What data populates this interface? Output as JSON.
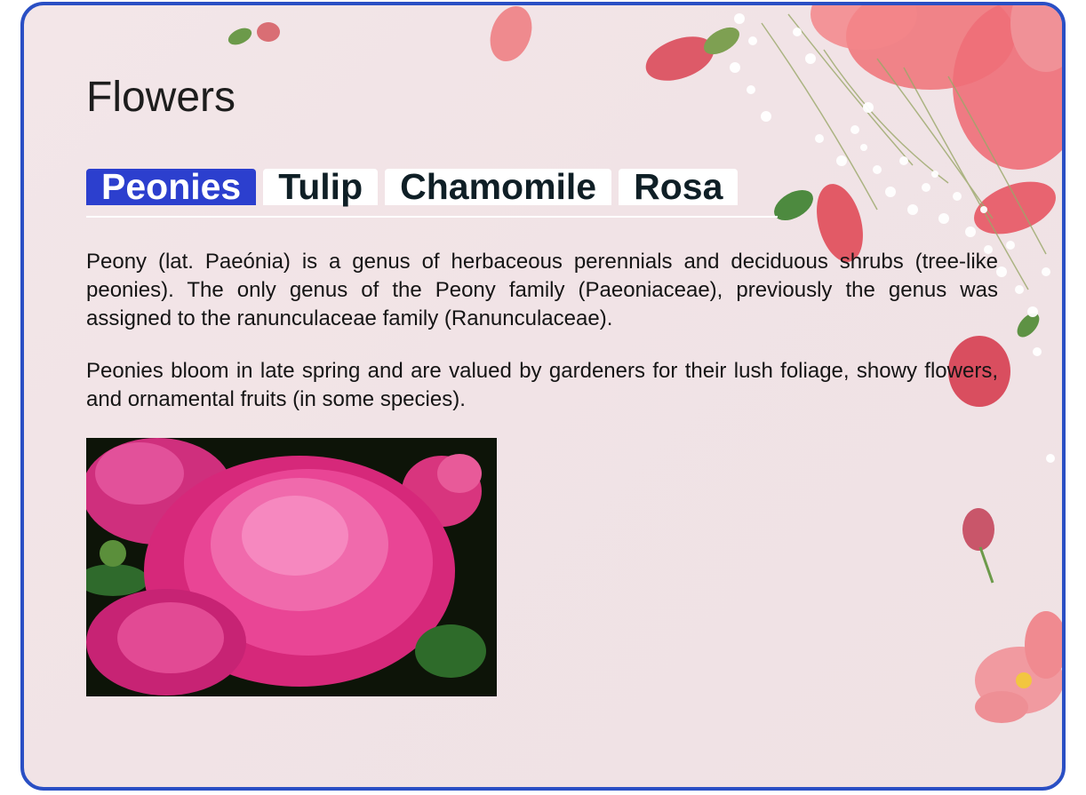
{
  "page": {
    "title": "Flowers"
  },
  "tabs": [
    {
      "label": "Peonies",
      "active": true
    },
    {
      "label": "Tulip",
      "active": false
    },
    {
      "label": "Chamomile",
      "active": false
    },
    {
      "label": "Rosa",
      "active": false
    }
  ],
  "content": {
    "paragraphs": [
      "Peony (lat. Paeónia) is a genus of herbaceous perennials and deciduous shrubs (tree-like peonies). The only genus of the Peony family (Paeoniaceae), previously the genus was assigned to the ranunculaceae family (Ranunculaceae).",
      "Peonies bloom in late spring and are valued by gardeners for their lush foliage, showy flowers, and ornamental fruits (in some species)."
    ],
    "image": {
      "subject": "pink peony flowers photo"
    }
  },
  "colors": {
    "frame_border": "#2a4fc4",
    "active_tab": "#2c3fce",
    "background": "#f2e5e7",
    "petal_pink": "#ec6f7a",
    "peony_pink": "#e0398c"
  }
}
